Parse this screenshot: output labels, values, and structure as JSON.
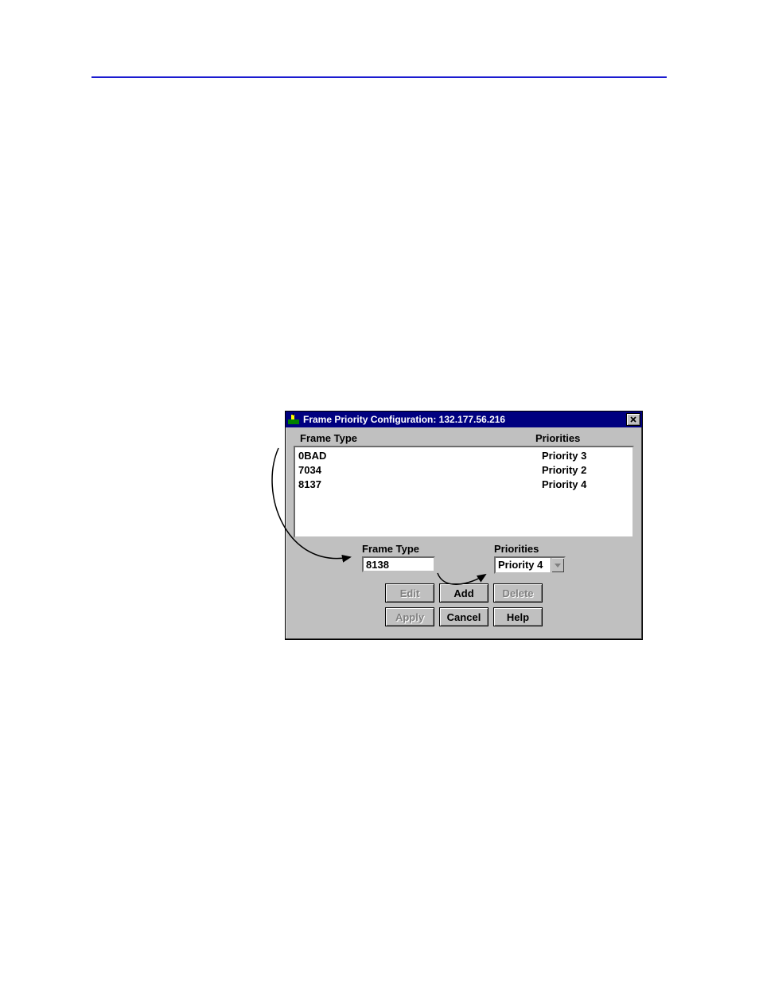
{
  "dialog": {
    "title": "Frame Priority Configuration: 132.177.56.216",
    "list_header_frame_type": "Frame Type",
    "list_header_priorities": "Priorities",
    "rows": [
      {
        "frame_type": "0BAD",
        "priority": "Priority 3"
      },
      {
        "frame_type": "7034",
        "priority": "Priority 2"
      },
      {
        "frame_type": "8137",
        "priority": "Priority 4"
      }
    ],
    "edit": {
      "frame_type_label": "Frame Type",
      "frame_type_value": "8138",
      "priorities_label": "Priorities",
      "priorities_value": "Priority 4"
    },
    "buttons": {
      "edit": "Edit",
      "add": "Add",
      "delete": "Delete",
      "apply": "Apply",
      "cancel": "Cancel",
      "help": "Help"
    }
  }
}
